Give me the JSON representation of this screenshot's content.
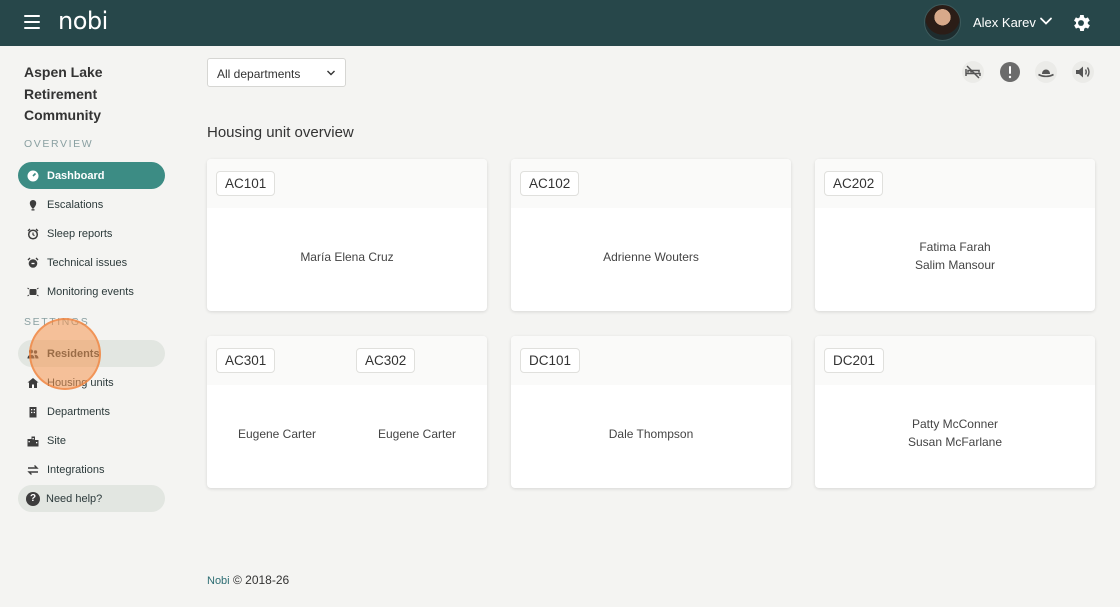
{
  "topbar": {
    "menu_icon": "hamburger-icon",
    "logo": "nobi",
    "user": {
      "name": "Alex Karev",
      "avatar": "user-avatar",
      "chevron": "chevron-down-icon"
    },
    "settings_icon": "gear-icon"
  },
  "sidebar": {
    "org_name": "Aspen Lake Retirement Community",
    "overview_label": "OVERVIEW",
    "settings_label": "SETTINGS",
    "overview_items": [
      {
        "label": "Dashboard",
        "icon": "dashboard-gauge-icon",
        "active": true
      },
      {
        "label": "Escalations",
        "icon": "escalation-pin-icon"
      },
      {
        "label": "Sleep reports",
        "icon": "alarm-clock-icon"
      },
      {
        "label": "Technical issues",
        "icon": "wrench-alarm-icon"
      },
      {
        "label": "Monitoring events",
        "icon": "monitor-activity-icon"
      }
    ],
    "settings_items": [
      {
        "label": "Residents",
        "icon": "people-icon",
        "hovered": true
      },
      {
        "label": "Housing units",
        "icon": "house-icon"
      },
      {
        "label": "Departments",
        "icon": "building-icon"
      },
      {
        "label": "Site",
        "icon": "site-buildings-icon"
      },
      {
        "label": "Integrations",
        "icon": "swap-arrows-icon"
      }
    ],
    "help": {
      "label": "Need help?",
      "icon": "question-circle-icon"
    }
  },
  "filters": {
    "department": {
      "selected": "All departments",
      "icon": "chevron-down-icon"
    }
  },
  "toolbar_icons": [
    "bed-off-icon",
    "alert-circle-icon",
    "hat-icon",
    "speaker-icon"
  ],
  "main": {
    "title": "Housing unit overview",
    "cards": [
      {
        "units": [
          {
            "code": "AC101",
            "residents": [
              "María Elena Cruz"
            ]
          }
        ]
      },
      {
        "units": [
          {
            "code": "AC102",
            "residents": [
              "Adrienne Wouters"
            ]
          }
        ]
      },
      {
        "units": [
          {
            "code": "AC202",
            "residents": [
              "Fatima Farah",
              "Salim Mansour"
            ]
          }
        ]
      },
      {
        "units": [
          {
            "code": "AC301",
            "residents": [
              "Eugene Carter"
            ]
          },
          {
            "code": "AC302",
            "residents": [
              "Eugene Carter"
            ]
          }
        ]
      },
      {
        "units": [
          {
            "code": "DC101",
            "residents": [
              "Dale Thompson"
            ]
          }
        ]
      },
      {
        "units": [
          {
            "code": "DC201",
            "residents": [
              "Patty McConner",
              "Susan McFarlane"
            ]
          }
        ]
      }
    ]
  },
  "footer": {
    "brand": "Nobi",
    "copyright": "© 2018-26"
  },
  "colors": {
    "topbar": "#27474a",
    "accent": "#3c8c84",
    "background": "#f4f4f2"
  }
}
